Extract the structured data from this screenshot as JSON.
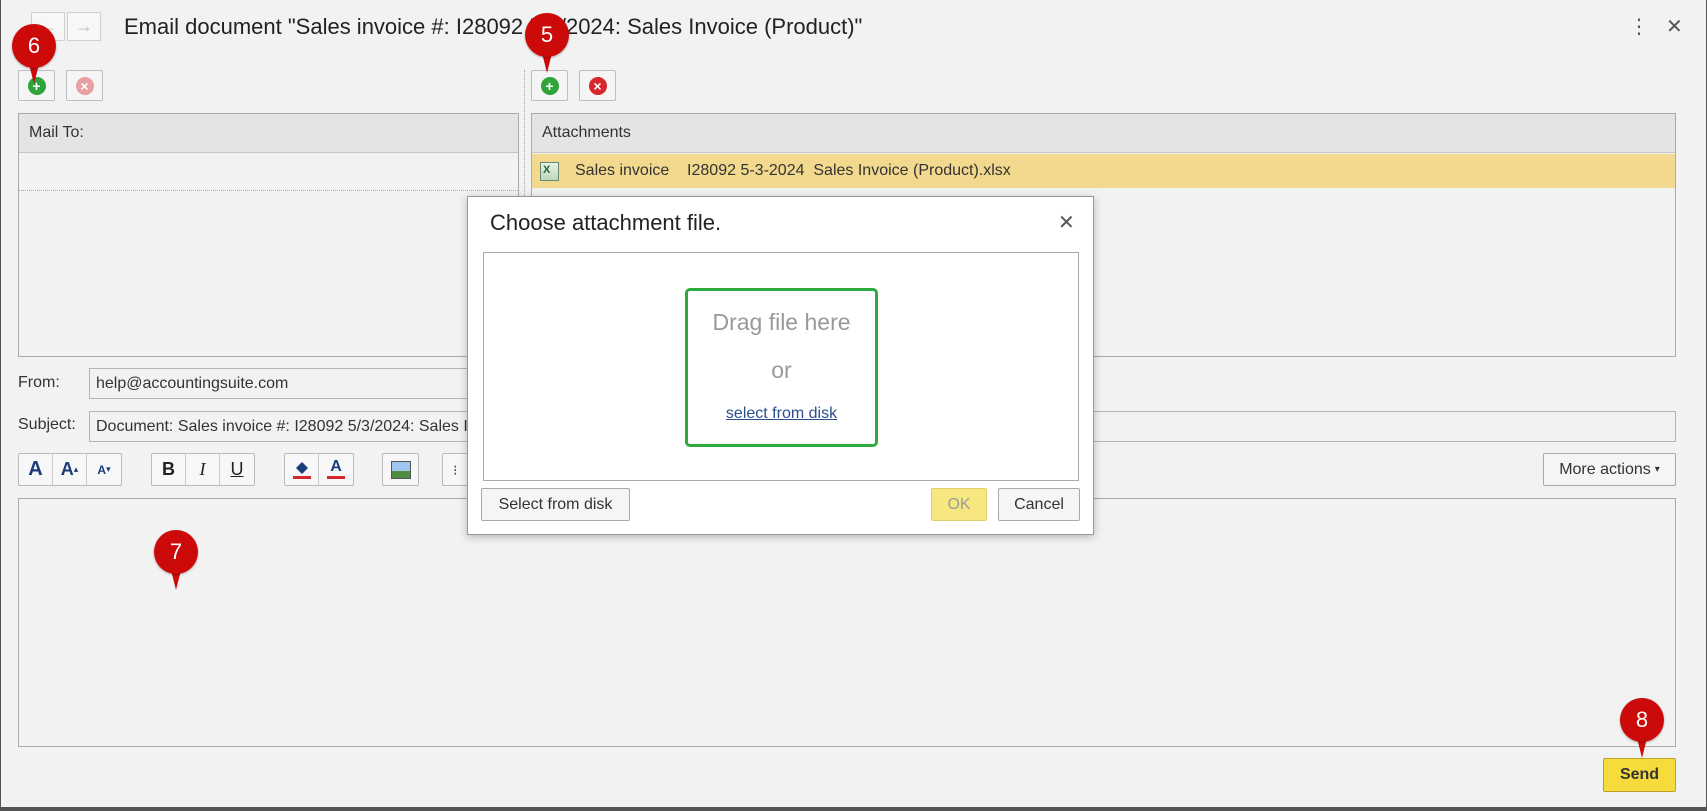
{
  "window": {
    "title": "Email document \"Sales invoice #: I28092 5/3/2024: Sales Invoice (Product)\""
  },
  "nav": {
    "back_icon": "arrow-left-icon",
    "forward_icon": "arrow-right-icon",
    "back_glyph": "←",
    "forward_glyph": "→"
  },
  "titlebar_icons": {
    "menu_glyph": "⋮",
    "close_glyph": "✕"
  },
  "mail_to": {
    "header": "Mail To:"
  },
  "attachments": {
    "header": "Attachments",
    "rows": [
      {
        "name": "Sales invoice    I28092 5-3-2024  Sales Invoice (Product).xlsx",
        "icon": "excel-file-icon"
      }
    ]
  },
  "form": {
    "from_label": "From:",
    "from_value": "help@accountingsuite.com",
    "subject_label": "Subject:",
    "subject_value": "Document: Sales invoice #: I28092 5/3/2024: Sales Invoice (Product)"
  },
  "toolbar": {
    "font_large": "A",
    "font_grow": "A",
    "font_shrink": "A",
    "bold": "B",
    "italic": "I",
    "underline": "U",
    "more_actions": "More actions",
    "caret": "▾"
  },
  "send": {
    "label": "Send"
  },
  "dialog": {
    "title": "Choose attachment file.",
    "drag_text": "Drag file here",
    "or_text": "or",
    "select_link": "select from disk",
    "select_button": "Select from disk",
    "ok_button": "OK",
    "cancel_button": "Cancel"
  },
  "markers": {
    "m5": "5",
    "m6": "6",
    "m7": "7",
    "m8": "8"
  },
  "colors": {
    "accent_yellow": "#f5dc3c",
    "selected_row": "#f2d98e",
    "dropzone_border": "#2eaa3e",
    "marker_red": "#cc0a0a"
  }
}
